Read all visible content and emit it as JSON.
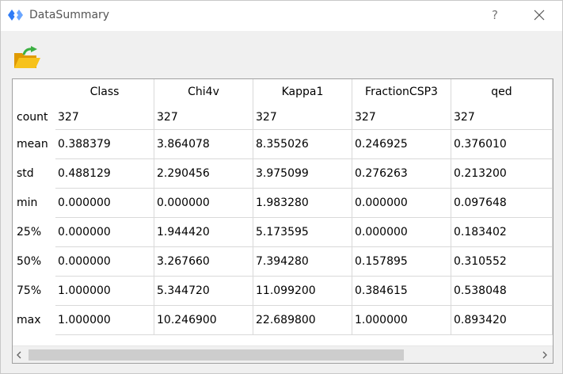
{
  "window": {
    "title": "DataSummary",
    "help_label": "?"
  },
  "icons": {
    "app": "diamond-logo-icon",
    "help": "question-icon",
    "close": "close-icon",
    "open_folder": "open-folder-icon",
    "scroll_left": "chevron-left-icon",
    "scroll_right": "chevron-right-icon"
  },
  "table": {
    "columns": [
      "Class",
      "Chi4v",
      "Kappa1",
      "FractionCSP3",
      "qed"
    ],
    "rows": [
      {
        "label": "count",
        "values": [
          "327",
          "327",
          "327",
          "327",
          "327"
        ]
      },
      {
        "label": "mean",
        "values": [
          "0.388379",
          "3.864078",
          "8.355026",
          "0.246925",
          "0.376010"
        ]
      },
      {
        "label": "std",
        "values": [
          "0.488129",
          "2.290456",
          "3.975099",
          "0.276263",
          "0.213200"
        ]
      },
      {
        "label": "min",
        "values": [
          "0.000000",
          "0.000000",
          "1.983280",
          "0.000000",
          "0.097648"
        ]
      },
      {
        "label": "25%",
        "values": [
          "0.000000",
          "1.944420",
          "5.173595",
          "0.000000",
          "0.183402"
        ]
      },
      {
        "label": "50%",
        "values": [
          "0.000000",
          "3.267660",
          "7.394280",
          "0.157895",
          "0.310552"
        ]
      },
      {
        "label": "75%",
        "values": [
          "1.000000",
          "5.344720",
          "11.099200",
          "0.384615",
          "0.538048"
        ]
      },
      {
        "label": "max",
        "values": [
          "1.000000",
          "10.246900",
          "22.689800",
          "1.000000",
          "0.893420"
        ]
      }
    ]
  },
  "colors": {
    "logo_blue": "#2f7cf6",
    "folder_yellow": "#f5b800",
    "arrow_green": "#3cb043"
  }
}
